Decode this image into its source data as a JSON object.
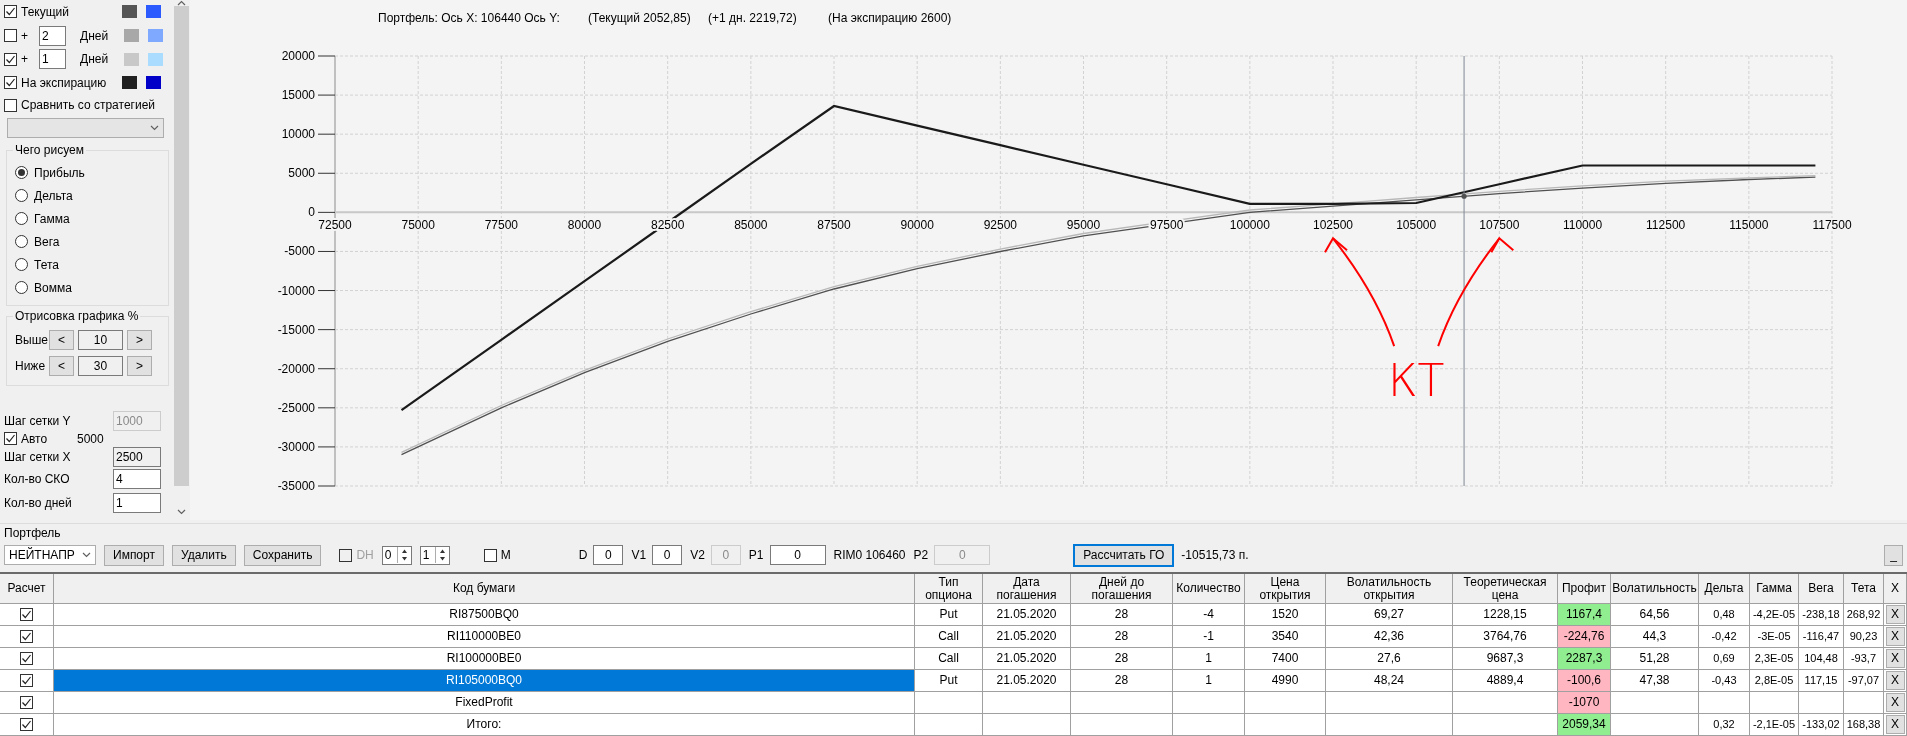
{
  "options_panel": {
    "curves": [
      {
        "kind": "plain",
        "label": "Текущий",
        "checked": true,
        "swatches": [
          {
            "color": "#555555"
          },
          {
            "color": "#2b5bff"
          }
        ]
      },
      {
        "kind": "days",
        "plus": "+",
        "days": "2",
        "unit": "Дней",
        "checked": false,
        "swatches": [
          {
            "color": "#a8a8a8"
          },
          {
            "color": "#7fa8ff"
          }
        ]
      },
      {
        "kind": "days",
        "plus": "+",
        "days": "1",
        "unit": "Дней",
        "checked": true,
        "swatches": [
          {
            "color": "#c8c8c8"
          },
          {
            "color": "#aadcff"
          }
        ]
      },
      {
        "kind": "plain",
        "label": "На экспирацию",
        "checked": true,
        "swatches": [
          {
            "color": "#202020"
          },
          {
            "color": "#0000c8"
          }
        ]
      }
    ],
    "compare": {
      "label": "Сравнить со стратегией",
      "checked": false
    },
    "draw_group": {
      "title": "Чего рисуем",
      "options": [
        {
          "label": "Прибыль",
          "selected": true
        },
        {
          "label": "Дельта",
          "selected": false
        },
        {
          "label": "Гамма",
          "selected": false
        },
        {
          "label": "Вега",
          "selected": false
        },
        {
          "label": "Тета",
          "selected": false
        },
        {
          "label": "Вомма",
          "selected": false
        }
      ]
    },
    "range_group": {
      "title": "Отрисовка графика %",
      "rows": [
        {
          "label": "Выше",
          "dec": "<",
          "value": "10",
          "inc": ">"
        },
        {
          "label": "Ниже",
          "dec": "<",
          "value": "30",
          "inc": ">"
        }
      ]
    },
    "grid_y": {
      "label": "Шаг сетки Y",
      "value": "1000",
      "disabled": true
    },
    "auto": {
      "label": "Авто",
      "checked": true,
      "reading": "5000"
    },
    "grid_x": {
      "label": "Шаг сетки X",
      "value": "2500",
      "disabled": false
    },
    "sko": {
      "label": "Кол-во СКО",
      "value": "4",
      "disabled": false
    },
    "days": {
      "label": "Кол-во дней",
      "value": "1",
      "disabled": false
    }
  },
  "chart": {
    "readout": "Портфель: Ось X: 106440 Ось Y:",
    "readings": [
      "(Текущий 2052,85)",
      "(+1 дн. 2219,72)",
      "(На экспирацию 2600)"
    ],
    "chart_data": {
      "type": "line",
      "grid": true,
      "x": [
        74500,
        77500,
        80000,
        82500,
        85000,
        87500,
        90000,
        92500,
        95000,
        97500,
        100000,
        102500,
        105000,
        107500,
        110000,
        112500,
        115000,
        117000
      ],
      "series": [
        {
          "color": "#505050",
          "values": [
            -31000,
            -25000,
            -20500,
            -16500,
            -13000,
            -9800,
            -7200,
            -5000,
            -3000,
            -1500,
            0,
            800,
            1600,
            2400,
            3100,
            3700,
            4200,
            4500
          ]
        },
        {
          "color": "#b8b8b8",
          "values": [
            -30700,
            -24700,
            -20200,
            -16200,
            -12700,
            -9500,
            -6900,
            -4700,
            -2700,
            -1200,
            300,
            1100,
            1900,
            2700,
            3400,
            4000,
            4400,
            4700
          ]
        },
        {
          "color": "#1a1a1a",
          "values": [
            -25300,
            -16300,
            -8800,
            -1300,
            6200,
            13600,
            11100,
            8600,
            6100,
            3600,
            1100,
            1100,
            1200,
            3600,
            6000,
            6000,
            6000,
            6000
          ]
        }
      ],
      "xlim": [
        72500,
        117500
      ],
      "ylim": [
        -35000,
        20000
      ],
      "xticks": [
        72500,
        75000,
        77500,
        80000,
        82500,
        85000,
        87500,
        90000,
        92500,
        95000,
        97500,
        100000,
        102500,
        105000,
        107500,
        110000,
        112500,
        115000,
        117500
      ],
      "yticks": [
        20000,
        15000,
        10000,
        5000,
        0,
        -5000,
        -10000,
        -15000,
        -20000,
        -25000,
        -30000,
        -35000
      ],
      "ref_lines": [
        {
          "value": 106440,
          "axis": "x"
        }
      ],
      "annotations": [
        "КТ"
      ]
    }
  },
  "portfolio": {
    "title": "Портфель",
    "toolbar": {
      "strategy": "НЕЙТНАПР",
      "buttons": [
        "Импорт",
        "Удалить",
        "Сохранить"
      ],
      "dh": {
        "label": "DH",
        "checked": false,
        "disabled": true
      },
      "spinners": [
        "0",
        "1"
      ],
      "m": {
        "label": "M",
        "checked": false
      },
      "fields": [
        {
          "kind": "field",
          "label": "D",
          "value": "0",
          "disabled": false
        },
        {
          "kind": "field",
          "label": "V1",
          "value": "0",
          "disabled": false
        },
        {
          "kind": "field",
          "label": "V2",
          "value": "0",
          "disabled": true
        },
        {
          "kind": "field",
          "label": "P1",
          "value": "0",
          "disabled": false
        },
        {
          "kind": "text",
          "text": "RIM0 106460"
        },
        {
          "kind": "field",
          "label": "P2",
          "value": "0",
          "disabled": true
        }
      ],
      "calc_button": "Рассчитать ГО",
      "calc_focused": true,
      "go_result": "-10515,73 п.",
      "minimize": "_"
    },
    "table": {
      "columns": [
        "Расчет",
        "Код бумаги",
        "Тип опциона",
        "Дата погашения",
        "Дней до погашения",
        "Количество",
        "Цена открытия",
        "Волатильность открытия",
        "Теоретическая цена",
        "Профит",
        "Волатильность",
        "Дельта",
        "Гамма",
        "Вега",
        "Тета",
        "X"
      ],
      "rows": [
        {
          "calc": true,
          "selected": false,
          "color": "#90ee90",
          "cells": [
            "",
            "RI87500BQ0",
            "Put",
            "21.05.2020",
            "28",
            "-4",
            "1520",
            "69,27",
            "1228,15",
            "1167,4",
            "64,56",
            "0,48",
            "-4,2E-05",
            "-238,18",
            "268,92",
            "X"
          ]
        },
        {
          "calc": true,
          "selected": false,
          "color": "#ffb6c1",
          "cells": [
            "",
            "RI110000BE0",
            "Call",
            "21.05.2020",
            "28",
            "-1",
            "3540",
            "42,36",
            "3764,76",
            "-224,76",
            "44,3",
            "-0,42",
            "-3E-05",
            "-116,47",
            "90,23",
            "X"
          ]
        },
        {
          "calc": true,
          "selected": false,
          "color": "#90ee90",
          "cells": [
            "",
            "RI100000BE0",
            "Call",
            "21.05.2020",
            "28",
            "1",
            "7400",
            "27,6",
            "9687,3",
            "2287,3",
            "51,28",
            "0,69",
            "2,3E-05",
            "104,48",
            "-93,7",
            "X"
          ]
        },
        {
          "calc": true,
          "selected": true,
          "color": "#ffb6c1",
          "cells": [
            "",
            "RI105000BQ0",
            "Put",
            "21.05.2020",
            "28",
            "1",
            "4990",
            "48,24",
            "4889,4",
            "-100,6",
            "47,38",
            "-0,43",
            "2,8E-05",
            "117,15",
            "-97,07",
            "X"
          ]
        },
        {
          "calc": true,
          "selected": false,
          "color": "#ffb6c1",
          "cells": [
            "",
            "FixedProfit",
            "",
            "",
            "",
            "",
            "",
            "",
            "",
            "-1070",
            "",
            "",
            "",
            "",
            "",
            "X"
          ]
        },
        {
          "calc": true,
          "selected": false,
          "color": "#90ee90",
          "cells": [
            "",
            "Итого:",
            "",
            "",
            "",
            "",
            "",
            "",
            "",
            "2059,34",
            "",
            "0,32",
            "-2,1E-05",
            "-133,02",
            "168,38",
            "X"
          ]
        }
      ]
    }
  }
}
